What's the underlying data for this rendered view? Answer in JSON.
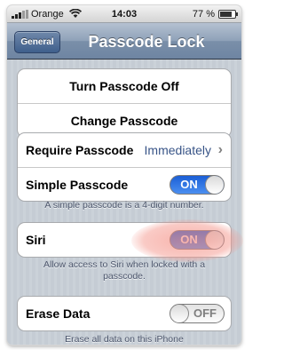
{
  "status_bar": {
    "carrier": "Orange",
    "time": "14:03",
    "battery_percent": "77 %"
  },
  "nav": {
    "back_label": "General",
    "title": "Passcode Lock"
  },
  "passcode_actions": {
    "turn_off_label": "Turn Passcode Off",
    "change_label": "Change Passcode"
  },
  "require": {
    "label": "Require Passcode",
    "value": "Immediately"
  },
  "simple": {
    "label": "Simple Passcode",
    "toggle": "ON",
    "footnote": "A simple passcode is a 4-digit number."
  },
  "siri": {
    "label": "Siri",
    "toggle": "ON",
    "footnote": "Allow access to Siri when locked with a passcode."
  },
  "erase": {
    "label": "Erase Data",
    "toggle": "OFF",
    "footnote": "Erase all data on this iPhone"
  },
  "colors": {
    "nav_bar": "#7a8fa9",
    "toggle_on": "#1b5fd6",
    "detail_text": "#385487",
    "highlight": "#f4897d"
  }
}
